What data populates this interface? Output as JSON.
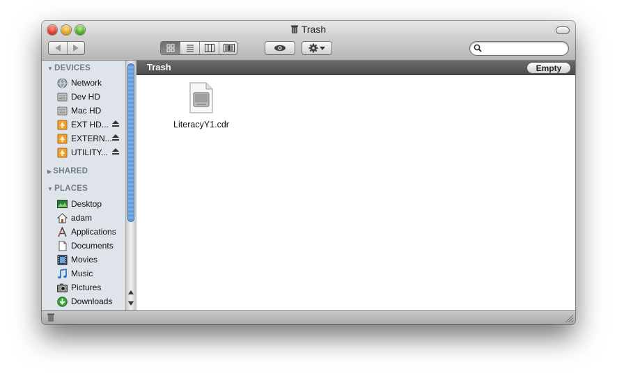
{
  "window": {
    "title": "Trash"
  },
  "toolbar": {
    "back_icon": "back-arrow-icon",
    "forward_icon": "forward-arrow-icon",
    "view_modes": [
      {
        "icon": "icon-view-icon",
        "selected": true
      },
      {
        "icon": "list-view-icon",
        "selected": false
      },
      {
        "icon": "column-view-icon",
        "selected": false
      },
      {
        "icon": "coverflow-view-icon",
        "selected": false
      }
    ],
    "quicklook_icon": "eye-icon",
    "action_icon": "gear-icon",
    "search": {
      "placeholder": "",
      "value": ""
    }
  },
  "sidebar": {
    "devices_header": "DEVICES",
    "devices": [
      {
        "label": "Network",
        "icon": "network-globe-icon",
        "eject": false
      },
      {
        "label": "Dev HD",
        "icon": "hard-drive-icon",
        "eject": false
      },
      {
        "label": "Mac HD",
        "icon": "hard-drive-icon",
        "eject": false
      },
      {
        "label": "EXT HD...",
        "icon": "external-drive-icon",
        "eject": true
      },
      {
        "label": "EXTERN...",
        "icon": "external-drive-icon",
        "eject": true
      },
      {
        "label": "UTILITY...",
        "icon": "external-drive-icon",
        "eject": true
      }
    ],
    "shared_header": "SHARED",
    "places_header": "PLACES",
    "places": [
      {
        "label": "Desktop",
        "icon": "desktop-icon"
      },
      {
        "label": "adam",
        "icon": "home-icon"
      },
      {
        "label": "Applications",
        "icon": "applications-icon"
      },
      {
        "label": "Documents",
        "icon": "documents-icon"
      },
      {
        "label": "Movies",
        "icon": "movies-icon"
      },
      {
        "label": "Music",
        "icon": "music-note-icon"
      },
      {
        "label": "Pictures",
        "icon": "camera-icon"
      },
      {
        "label": "Downloads",
        "icon": "download-arrow-icon"
      }
    ]
  },
  "pathbar": {
    "title": "Trash",
    "empty_label": "Empty"
  },
  "files": [
    {
      "name": "LiteracyY1.cdr",
      "icon": "disk-image-document-icon"
    }
  ],
  "colors": {
    "sidebar_bg": "#dee4ea",
    "pathbar_bg": "#5b5b5b",
    "scroll_thumb": "#5d95d8"
  }
}
